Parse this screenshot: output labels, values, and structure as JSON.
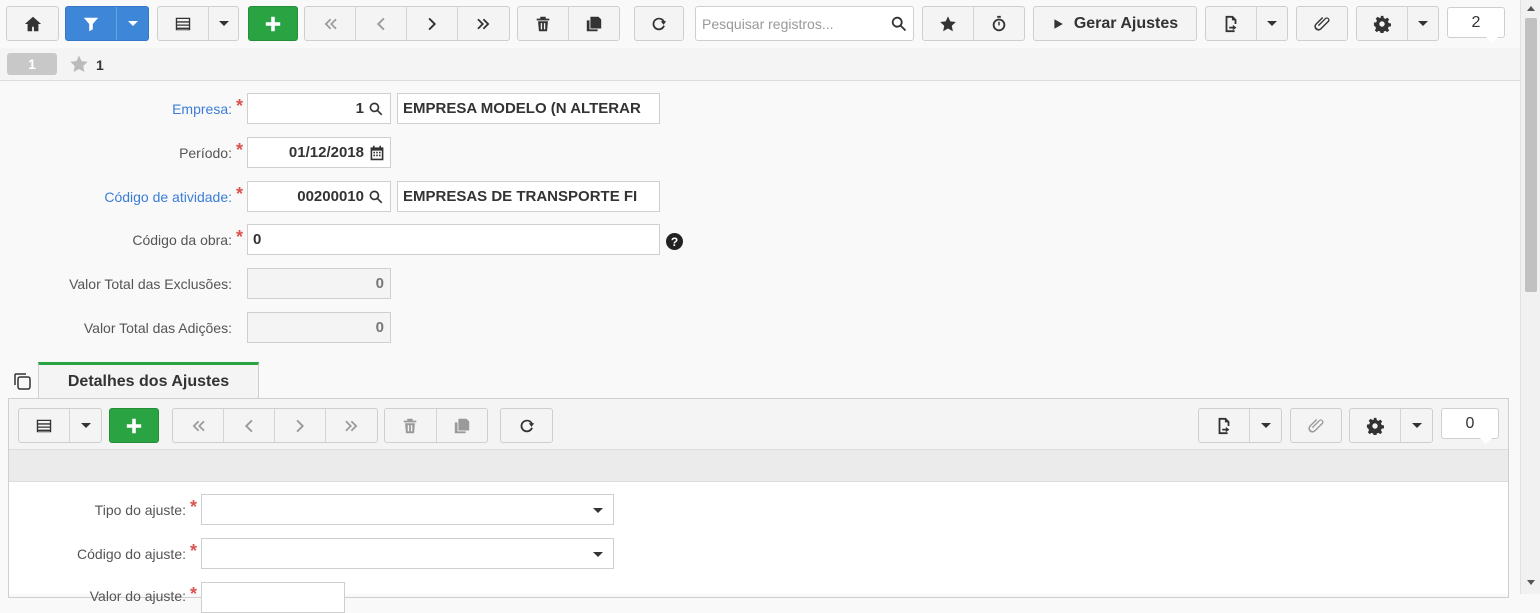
{
  "search": {
    "placeholder": "Pesquisar registros..."
  },
  "toolbar": {
    "gerar_label": "Gerar Ajustes",
    "record_count": "2"
  },
  "record_tabs": {
    "active": "1",
    "favorite_label": "1"
  },
  "form": {
    "empresa": {
      "label": "Empresa:",
      "code": "1",
      "name": "EMPRESA MODELO (N ALTERAR"
    },
    "periodo": {
      "label": "Período:",
      "value": "01/12/2018"
    },
    "atividade": {
      "label": "Código de atividade:",
      "code": "00200010",
      "name": "EMPRESAS DE TRANSPORTE FI"
    },
    "obra": {
      "label": "Código da obra:",
      "value": "0"
    },
    "exclusoes": {
      "label": "Valor Total das Exclusões:",
      "value": "0"
    },
    "adicoes": {
      "label": "Valor Total das Adições:",
      "value": "0"
    }
  },
  "detail": {
    "tab_label": "Detalhes dos Ajustes",
    "record_count": "0",
    "tipo_label": "Tipo do ajuste:",
    "codigo_label": "Código do ajuste:",
    "valor_label": "Valor do ajuste:"
  },
  "colors": {
    "primary": "#3d86d8",
    "success": "#2aa442",
    "required": "#d9534f",
    "link": "#3b7dd8"
  }
}
